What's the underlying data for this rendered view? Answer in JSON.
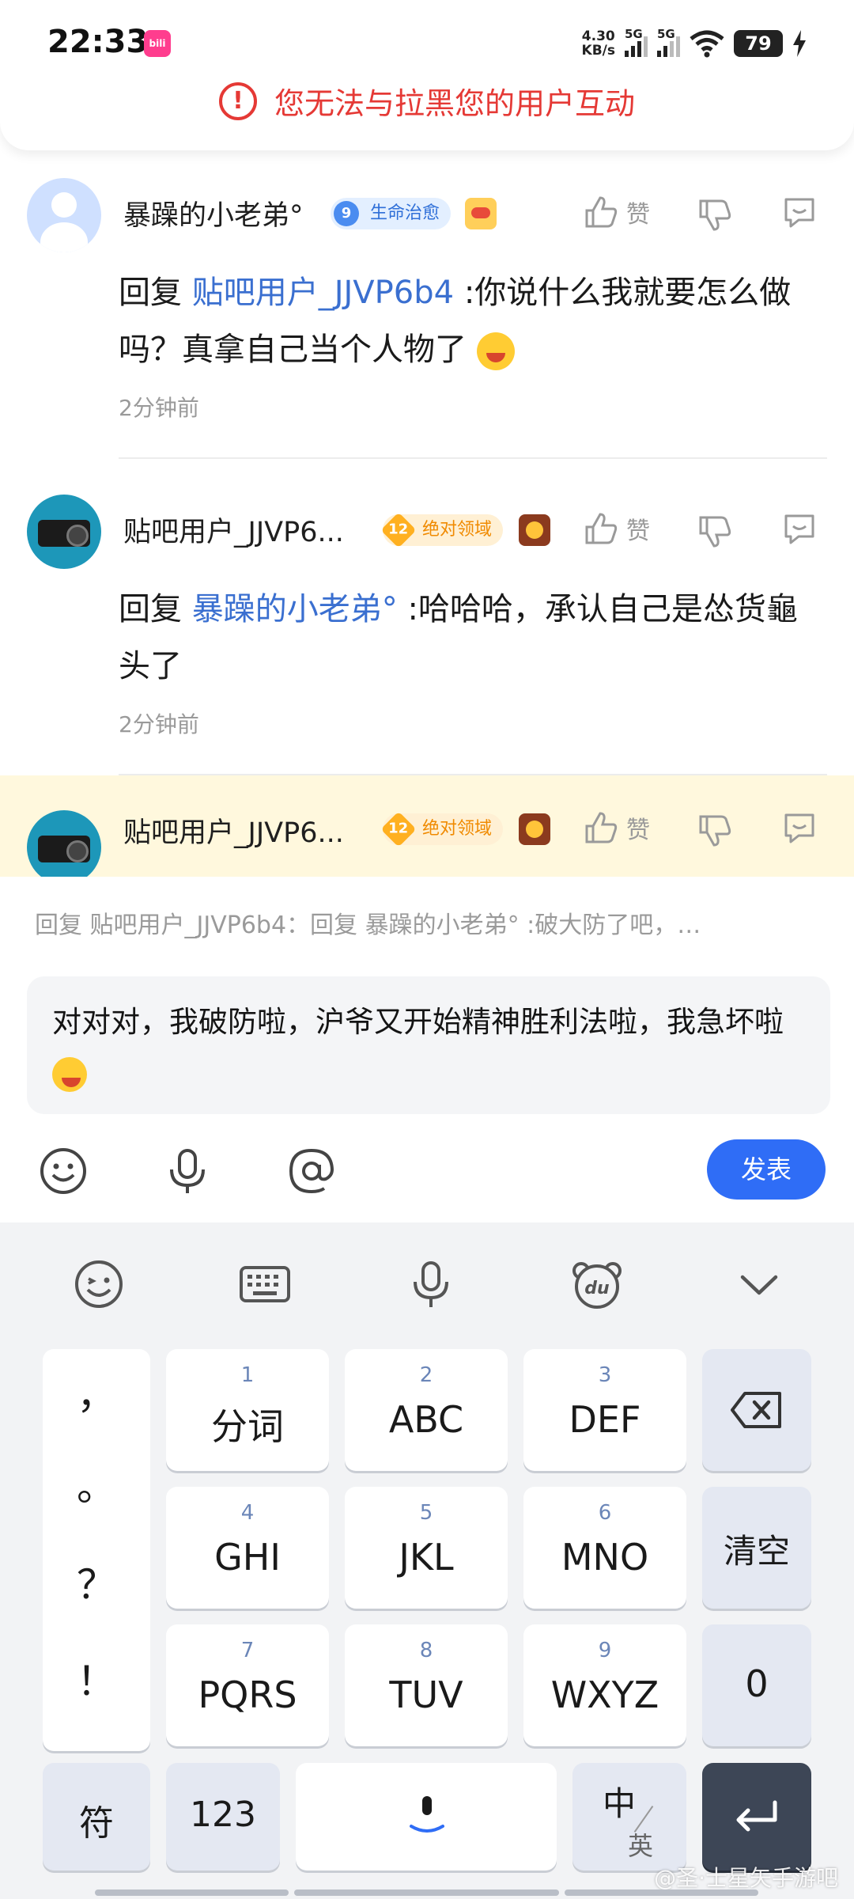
{
  "status_bar": {
    "time": "22:33",
    "app_badge": "bili",
    "net_speed_value": "4.30",
    "net_speed_unit": "KB/s",
    "signal_1": "5G",
    "signal_2": "5G",
    "battery": "79"
  },
  "toast": {
    "message": "您无法与拉黑您的用户互动"
  },
  "actions": {
    "like_label": "赞"
  },
  "comments": [
    {
      "username": "暴躁的小老弟°",
      "level": "9",
      "badge": "生命治愈",
      "reply_prefix": "回复",
      "mention": "贴吧用户_JJVP6b4",
      "text": ":你说什么我就要怎么做吗？真拿自己当个人物了",
      "time": "2分钟前"
    },
    {
      "username": "贴吧用户_JJVP6...",
      "level": "12",
      "badge": "绝对领域",
      "reply_prefix": "回复",
      "mention": "暴躁的小老弟°",
      "text": ":哈哈哈，承认自己是怂货龜头了",
      "time": "2分钟前"
    },
    {
      "username": "贴吧用户_JJVP6...",
      "level": "12",
      "badge": "绝对领域"
    }
  ],
  "reply_box": {
    "preview": "回复 贴吧用户_JJVP6b4：回复 暴躁的小老弟° :破大防了吧，…",
    "input_text": "对对对，我破防啦，沪爷又开始精神胜利法啦，我急坏啦",
    "post_label": "发表"
  },
  "keyboard": {
    "punct_keys": [
      "，",
      "。",
      "？",
      "！"
    ],
    "keys": [
      {
        "num": "1",
        "label": "分词"
      },
      {
        "num": "2",
        "label": "ABC"
      },
      {
        "num": "3",
        "label": "DEF"
      },
      {
        "num": "4",
        "label": "GHI"
      },
      {
        "num": "5",
        "label": "JKL"
      },
      {
        "num": "6",
        "label": "MNO"
      },
      {
        "num": "7",
        "label": "PQRS"
      },
      {
        "num": "8",
        "label": "TUV"
      },
      {
        "num": "9",
        "label": "WXYZ"
      }
    ],
    "clear_label": "清空",
    "zero_label": "0",
    "symbol_label": "符",
    "num_mode_label": "123",
    "lang_main": "中",
    "lang_alt": "英"
  },
  "watermark": "@圣·士星矢手游吧"
}
